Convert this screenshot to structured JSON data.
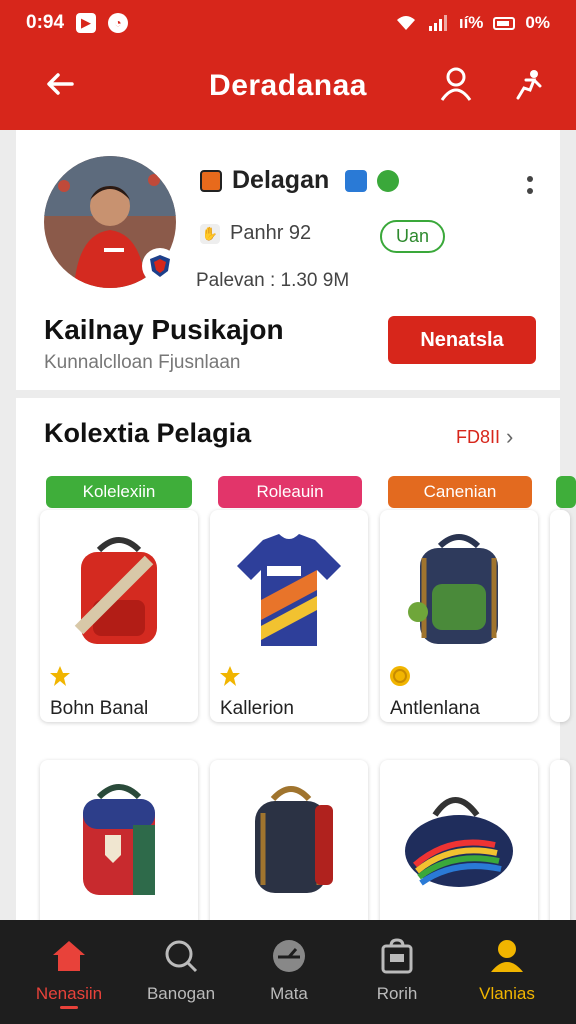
{
  "status": {
    "time": "0:94",
    "battery_text": "0%",
    "signal_text": "ıí%"
  },
  "header": {
    "title": "Deradanaa"
  },
  "profile": {
    "name": "Delagan",
    "position": "Panhr  92",
    "badge": "Uan",
    "meta": "Palevan : 1.30 9M",
    "display_name": "Kailnay Pusikajon",
    "subtitle": "Kunnalclloan Fjusnlaan",
    "cta_label": "Nenatsla"
  },
  "section": {
    "title": "Kolextia Pelagia",
    "see_all": "FD8II"
  },
  "chips": [
    {
      "label": "Kolelexiin",
      "color": "#3fae3a"
    },
    {
      "label": "Roleauin",
      "color": "#e2356a"
    },
    {
      "label": "Canenian",
      "color": "#e36a1f"
    }
  ],
  "cards_row1": [
    {
      "label": "Bohn Banal",
      "icon": "star-icon"
    },
    {
      "label": "Kallerion",
      "icon": "star-icon"
    },
    {
      "label": "Antlenlana",
      "icon": "coin-icon"
    }
  ],
  "nav": [
    {
      "label": "Nenasiin",
      "icon": "home-icon"
    },
    {
      "label": "Banogan",
      "icon": "search-icon"
    },
    {
      "label": "Mata",
      "icon": "gauge-icon"
    },
    {
      "label": "Rorih",
      "icon": "bag-icon"
    },
    {
      "label": "Vlanias",
      "icon": "user-icon"
    }
  ],
  "colors": {
    "primary": "#d7261b",
    "nav_bg": "#1e1e1e",
    "accent_yellow": "#f1b500"
  }
}
